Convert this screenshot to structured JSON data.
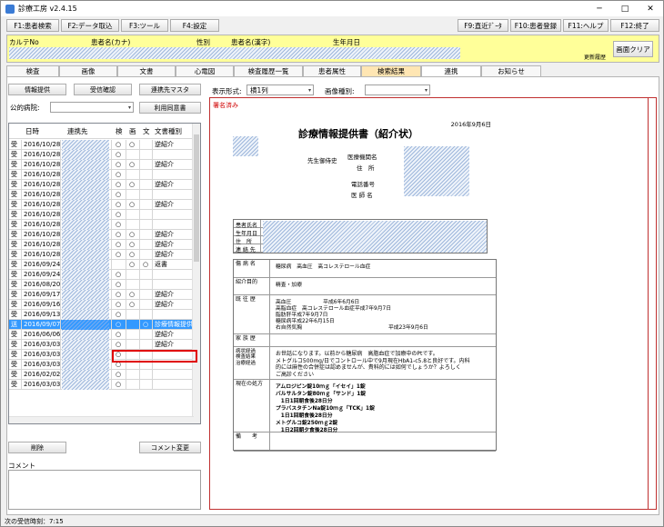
{
  "title": "診療工房 v2.4.15",
  "window_buttons": {
    "minimize": "─",
    "maximize": "□",
    "close": "✕"
  },
  "fkeys": [
    "F1:患者検索",
    "F2:データ取込",
    "F3:ツール",
    "F4:設定",
    "F9:直近ﾃﾞｰﾀ",
    "F10:患者登録",
    "F11:ヘルプ",
    "F12:終了"
  ],
  "patient": {
    "karte_no": "カルテNo",
    "name_kana": "患者名(カナ)",
    "sex": "性別",
    "name_kanji": "患者名(漢字)",
    "birthday": "生年月日",
    "updated": "更新履歴",
    "clear_button": "画面クリア"
  },
  "tabs": [
    "検査",
    "画像",
    "文書",
    "心電図",
    "検査履歴一覧",
    "患者属性",
    "検索結果",
    "連携",
    "お知らせ"
  ],
  "left": {
    "btn_info": "情報提供",
    "btn_receipt": "受信確認",
    "btn_master": "連携先マスタ",
    "hospital_label": "公的病院:",
    "btn_consent": "利用同意書",
    "btn_delete": "削除",
    "btn_comment": "コメント変更",
    "comment_label": "コメント"
  },
  "grid": {
    "headers": [
      "日時",
      "連携先",
      "検",
      "画",
      "文",
      "文書種別"
    ],
    "rows": [
      {
        "d": "受",
        "date": "2016/10/28",
        "k": "○",
        "g": "○",
        "b": "",
        "type": "逆紹介"
      },
      {
        "d": "受",
        "date": "2016/10/28",
        "k": "○",
        "g": "",
        "b": "",
        "type": ""
      },
      {
        "d": "受",
        "date": "2016/10/28",
        "k": "○",
        "g": "○",
        "b": "",
        "type": "逆紹介"
      },
      {
        "d": "受",
        "date": "2016/10/28",
        "k": "○",
        "g": "",
        "b": "",
        "type": ""
      },
      {
        "d": "受",
        "date": "2016/10/28",
        "k": "○",
        "g": "○",
        "b": "",
        "type": "逆紹介"
      },
      {
        "d": "受",
        "date": "2016/10/28",
        "k": "○",
        "g": "",
        "b": "",
        "type": ""
      },
      {
        "d": "受",
        "date": "2016/10/28",
        "k": "○",
        "g": "○",
        "b": "",
        "type": "逆紹介"
      },
      {
        "d": "受",
        "date": "2016/10/28",
        "k": "○",
        "g": "",
        "b": "",
        "type": ""
      },
      {
        "d": "受",
        "date": "2016/10/28",
        "k": "○",
        "g": "",
        "b": "",
        "type": ""
      },
      {
        "d": "受",
        "date": "2016/10/28",
        "k": "○",
        "g": "○",
        "b": "",
        "type": "逆紹介"
      },
      {
        "d": "受",
        "date": "2016/10/28",
        "k": "○",
        "g": "○",
        "b": "",
        "type": "逆紹介"
      },
      {
        "d": "受",
        "date": "2016/10/28",
        "k": "○",
        "g": "○",
        "b": "",
        "type": "逆紹介"
      },
      {
        "d": "受",
        "date": "2016/09/24",
        "k": "",
        "g": "○",
        "b": "○",
        "type": "返書"
      },
      {
        "d": "受",
        "date": "2016/09/24",
        "k": "○",
        "g": "",
        "b": "",
        "type": ""
      },
      {
        "d": "受",
        "date": "2016/08/20",
        "k": "○",
        "g": "",
        "b": "",
        "type": ""
      },
      {
        "d": "受",
        "date": "2016/09/17",
        "k": "○",
        "g": "○",
        "b": "",
        "type": "逆紹介"
      },
      {
        "d": "受",
        "date": "2016/09/16",
        "k": "○",
        "g": "○",
        "b": "",
        "type": "逆紹介"
      },
      {
        "d": "受",
        "date": "2016/09/13",
        "k": "○",
        "g": "",
        "b": "",
        "type": ""
      },
      {
        "d": "送",
        "date": "2016/09/07",
        "k": "○",
        "g": "",
        "b": "○",
        "type": "診療情報提供書"
      },
      {
        "d": "受",
        "date": "2016/06/06",
        "k": "○",
        "g": "",
        "b": "",
        "type": "逆紹介"
      },
      {
        "d": "受",
        "date": "2016/03/03",
        "k": "○",
        "g": "",
        "b": "",
        "type": "逆紹介"
      },
      {
        "d": "受",
        "date": "2016/03/03",
        "k": "○",
        "g": "",
        "b": "",
        "type": ""
      },
      {
        "d": "受",
        "date": "2016/03/03",
        "k": "○",
        "g": "",
        "b": "",
        "type": ""
      },
      {
        "d": "受",
        "date": "2016/02/02",
        "k": "○",
        "g": "",
        "b": "",
        "type": ""
      },
      {
        "d": "受",
        "date": "2016/03/03",
        "k": "○",
        "g": "",
        "b": "",
        "type": ""
      }
    ]
  },
  "viewer": {
    "display_label": "表示形式:",
    "display_value": "横1列",
    "image_type_label": "画像種別:",
    "image_type_value": "",
    "signed": "署名済み"
  },
  "doc": {
    "date": "2016年9月6日",
    "title": "診療情報提供書（紹介状）",
    "doctor_honor": "先生御侍史",
    "inst_name": "医療機関名",
    "addr": "住　所",
    "tel": "電話番号",
    "doctor": "医 師 名",
    "patient_rows": [
      "患者氏名",
      "生年月日",
      "住　所",
      "連 絡 先"
    ],
    "rows": [
      {
        "h": "傷 病 名",
        "v": [
          "糖尿病　高血圧　高コレステロール血症"
        ]
      },
      {
        "h": "紹介目的",
        "v": [
          "精査・加療"
        ]
      },
      {
        "h": "既 往 歴",
        "v": [
          "高血圧　　　　　　平成6年6月6日",
          "高脂血症　高コレステロール血症平成7年9月7日",
          "脂肪肝平成7年9月7日",
          "糖尿病平成22年6月15日",
          "右自然気胸",
          "平成23年9月6日"
        ]
      },
      {
        "h": "家 族 歴",
        "v": [
          ""
        ]
      },
      {
        "h": "病状経過\n検査結果\n治療経過",
        "v": [
          "お世話になります。以前から糖尿病　高脂血症で加療中のPtです。",
          "メトグルコ500mg/日でコントロール中で9月現在HbA1-c5.8と良好です。内科",
          "的には麻性の合併症は認めませんが、貴科的には如何でしょうか？よろしく",
          "ご高診ください"
        ]
      },
      {
        "h": "現在の処方",
        "v": [
          "アムロジピン錠10ｍｇ「イセイ」1錠",
          "バルサルタン錠80ｍｇ「サンド」1錠",
          "　1日1回朝食後28日分",
          "プラバスタチンNa錠10ｍｇ「TCK」1錠",
          "　1日1回朝食後28日分",
          "メトグルコ錠250ｍｇ2錠",
          "　1日2回朝夕食後28日分"
        ]
      },
      {
        "h": "備　　考",
        "v": [
          ""
        ]
      }
    ]
  },
  "status": "次の受信時刻：7:15"
}
